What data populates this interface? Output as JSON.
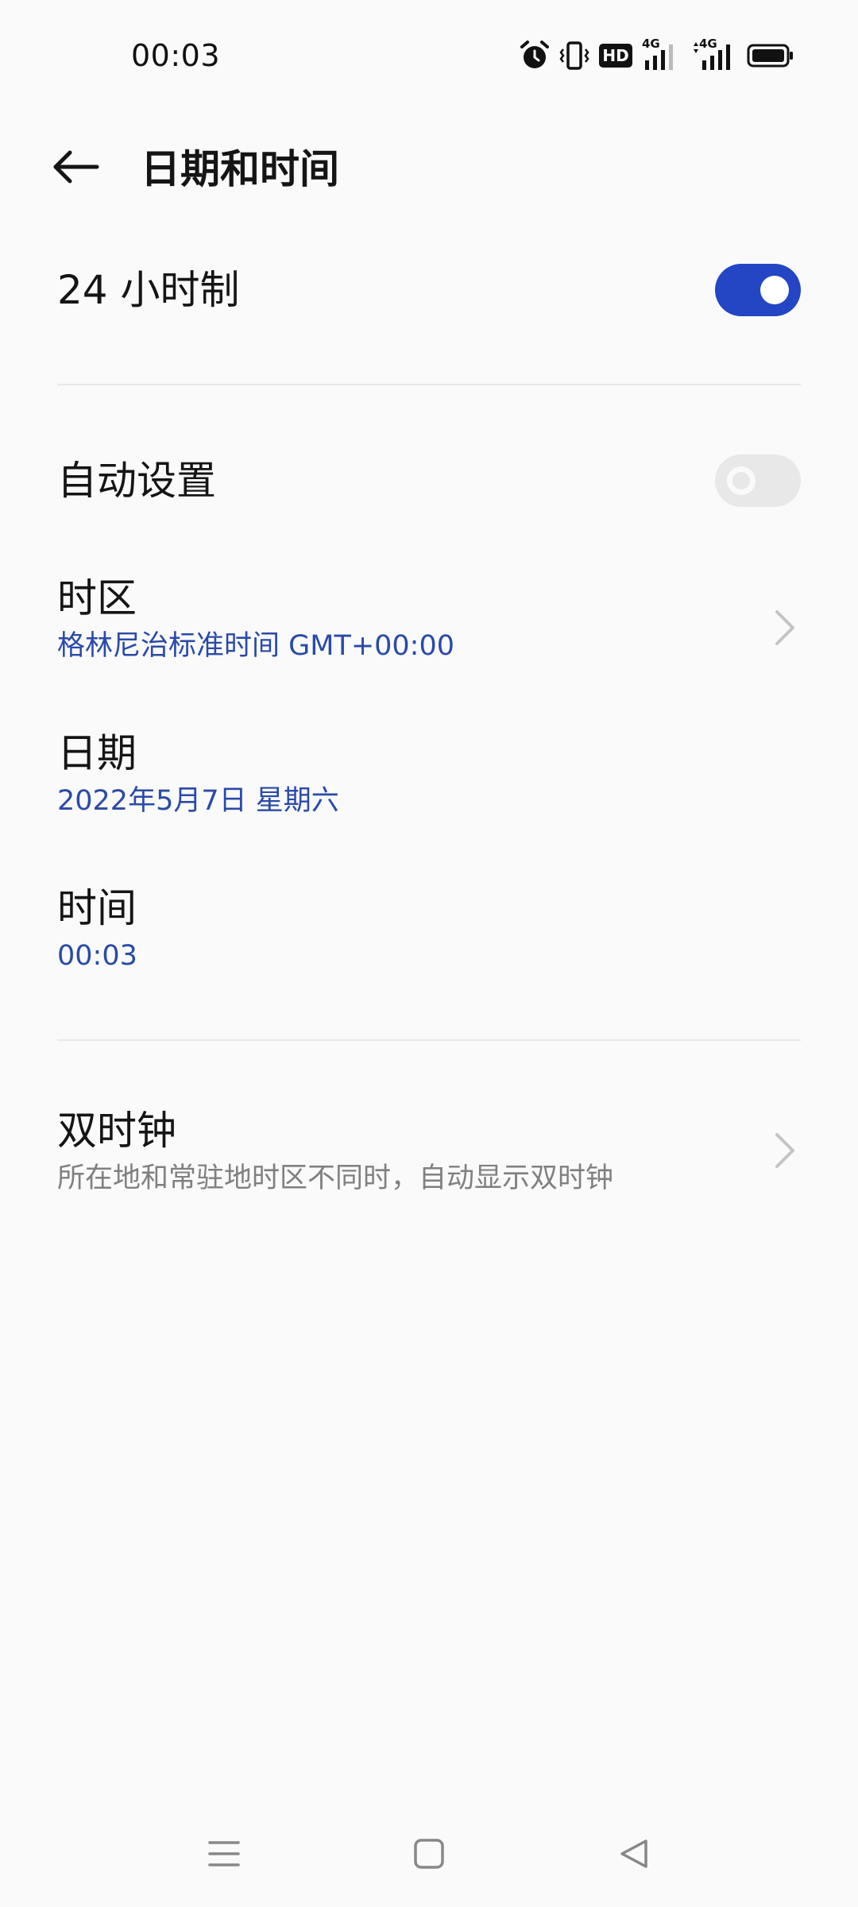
{
  "status_bar": {
    "time": "00:03",
    "hd_label": "HD",
    "network_1": "4G",
    "network_2": "4G",
    "icons": [
      "alarm-icon",
      "vibrate-icon",
      "hd-voice-icon",
      "signal-4g-icon",
      "signal-4g-icon",
      "battery-icon"
    ]
  },
  "header": {
    "title": "日期和时间",
    "back_icon": "back-arrow-icon"
  },
  "settings": {
    "hour24": {
      "label": "24 小时制",
      "enabled": true
    },
    "auto_set": {
      "label": "自动设置",
      "enabled": false
    },
    "timezone": {
      "label": "时区",
      "value": "格林尼治标准时间 GMT+00:00"
    },
    "date": {
      "label": "日期",
      "value": "2022年5月7日 星期六"
    },
    "time": {
      "label": "时间",
      "value": "00:03"
    },
    "dual_clock": {
      "label": "双时钟",
      "description": "所在地和常驻地时区不同时，自动显示双时钟"
    }
  },
  "nav_bar": {
    "icons": [
      "menu-icon",
      "home-icon",
      "back-icon"
    ]
  },
  "colors": {
    "accent": "#2446c4",
    "link_blue": "#2a4aa8",
    "background": "#fafafa",
    "divider": "#e8e8e8",
    "secondary_text": "#808080"
  }
}
